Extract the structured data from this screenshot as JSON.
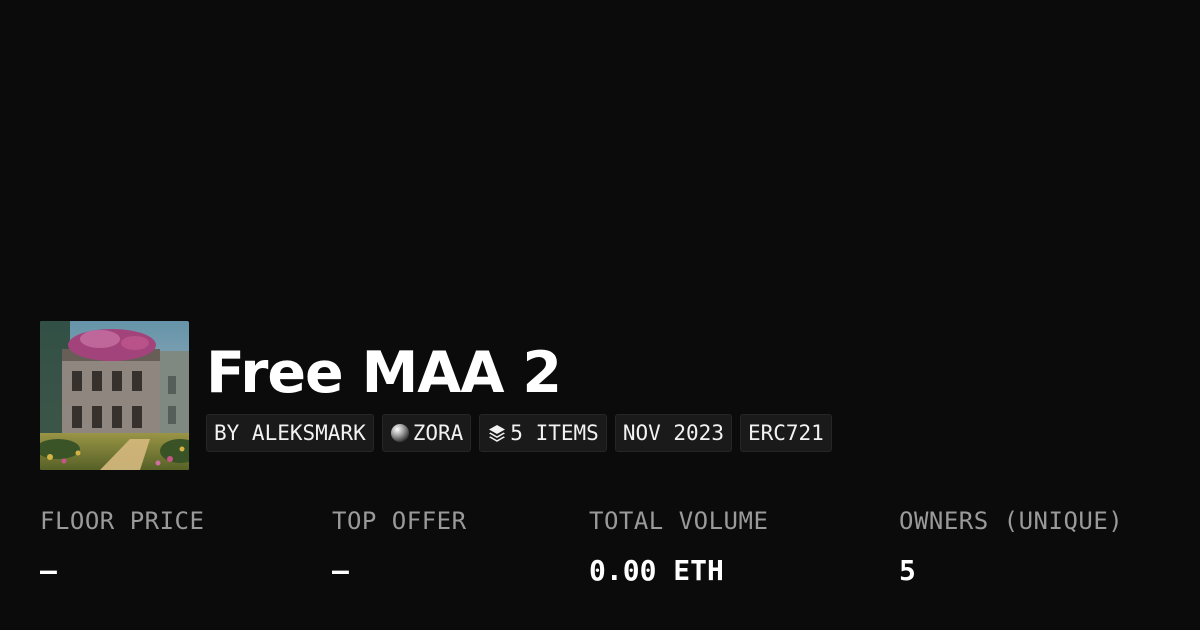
{
  "collection": {
    "title": "Free MAA 2",
    "thumbnail_icon": "collection-artwork-image"
  },
  "tags": [
    {
      "label": "BY ALEKSMARK",
      "icon": null
    },
    {
      "label": "ZORA",
      "icon": "zora-orb-icon"
    },
    {
      "label": "5 ITEMS",
      "icon": "layers-icon"
    },
    {
      "label": "NOV 2023",
      "icon": null
    },
    {
      "label": "ERC721",
      "icon": null
    }
  ],
  "stats": [
    {
      "label": "FLOOR PRICE",
      "value": "–"
    },
    {
      "label": "TOP OFFER",
      "value": "–"
    },
    {
      "label": "TOTAL VOLUME",
      "value": "0.00 ETH"
    },
    {
      "label": "OWNERS (UNIQUE)",
      "value": "5"
    }
  ],
  "colors": {
    "background": "#0b0b0b",
    "tag_background": "#1a1a1a",
    "label": "#9a9a9a",
    "value": "#ffffff"
  }
}
